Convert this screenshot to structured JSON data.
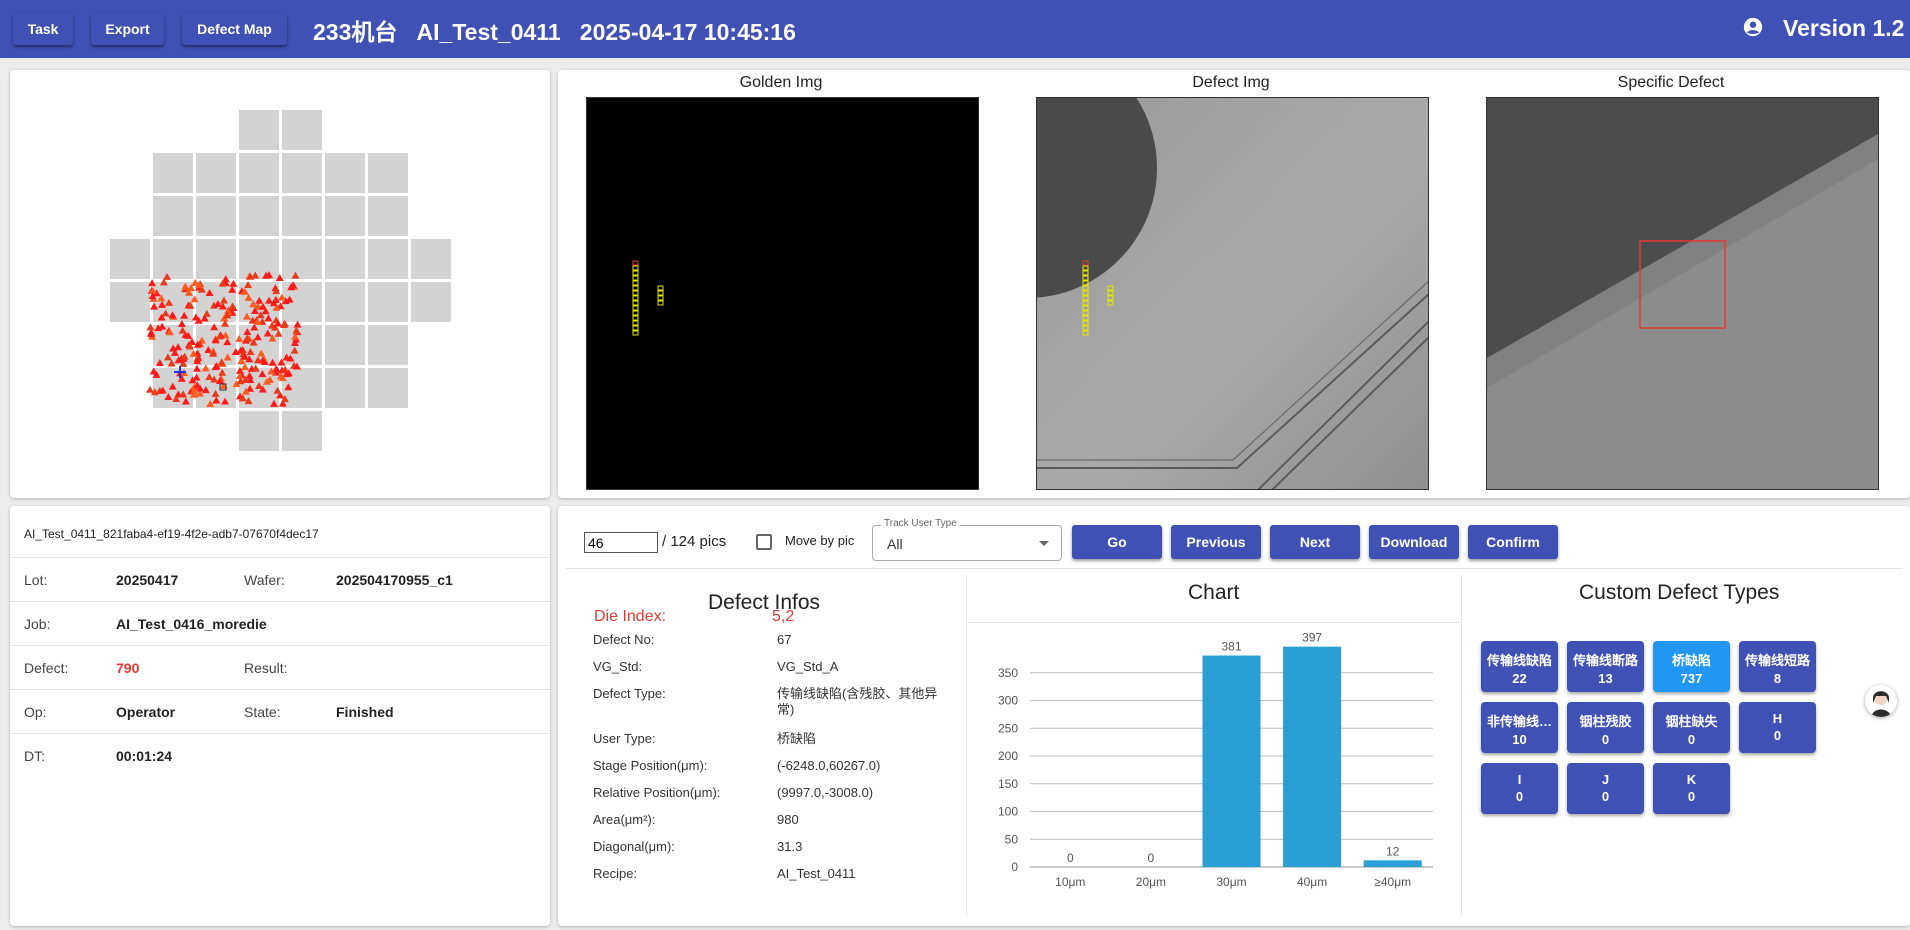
{
  "header": {
    "task_label": "Task",
    "export_label": "Export",
    "defect_map_label": "Defect Map",
    "title": "233机台   AI_Test_0411   2025-04-17 10:45:16",
    "account_icon": "account-circle-icon",
    "version": "Version 1.2"
  },
  "images": {
    "golden_title": "Golden Img",
    "defect_title": "Defect Img",
    "specific_title": "Specific Defect"
  },
  "info": {
    "id": "AI_Test_0411_821faba4-ef19-4f2e-adb7-07670f4dec17",
    "lot_label": "Lot:",
    "lot": "20250417",
    "wafer_label": "Wafer:",
    "wafer": "202504170955_c1",
    "job_label": "Job:",
    "job": "AI_Test_0416_moredie",
    "defect_label": "Defect:",
    "defect": "790",
    "result_label": "Result:",
    "result": "",
    "op_label": "Op:",
    "op": "Operator",
    "state_label": "State:",
    "state": "Finished",
    "dt_label": "DT:",
    "dt": "00:01:24"
  },
  "controls": {
    "page_value": "46",
    "page_total": "/ 124 pics",
    "move_by_pic_label": "Move by pic",
    "track_label": "Track User Type",
    "track_value": "All",
    "go": "Go",
    "previous": "Previous",
    "next": "Next",
    "download": "Download",
    "confirm": "Confirm"
  },
  "defect_infos": {
    "title": "Defect Infos",
    "die_index_label": "Die Index:",
    "die_index": "5,2",
    "rows": [
      {
        "k": "Defect No:",
        "v": "67"
      },
      {
        "k": "VG_Std:",
        "v": "VG_Std_A"
      },
      {
        "k": "Defect Type:",
        "v": "传输线缺陷(含残胶、其他异常)"
      },
      {
        "k": "User Type:",
        "v": "桥缺陷"
      },
      {
        "k": "Stage Position(μm):",
        "v": "(-6248.0,60267.0)"
      },
      {
        "k": "Relative Position(μm):",
        "v": "(9997.0,-3008.0)"
      },
      {
        "k": "Area(μm²):",
        "v": "980"
      },
      {
        "k": "Diagonal(μm):",
        "v": "31.3"
      },
      {
        "k": "Recipe:",
        "v": "AI_Test_0411"
      }
    ]
  },
  "chart_title": "Chart",
  "chart_data": {
    "type": "bar",
    "categories": [
      "10μm",
      "20μm",
      "30μm",
      "40μm",
      "≥40μm"
    ],
    "values": [
      0,
      0,
      381,
      397,
      12
    ],
    "ylim": [
      0,
      400
    ],
    "yticks": [
      0,
      50,
      100,
      150,
      200,
      250,
      300,
      350
    ],
    "grid": true,
    "bar_color": "#2a9fd6"
  },
  "custom_types": {
    "title": "Custom Defect Types",
    "items": [
      {
        "name": "传输线缺陷",
        "count": "22",
        "active": false
      },
      {
        "name": "传输线断路",
        "count": "13",
        "active": false
      },
      {
        "name": "桥缺陷",
        "count": "737",
        "active": true
      },
      {
        "name": "传输线短路",
        "count": "8",
        "active": false
      },
      {
        "name": "非传输线…",
        "count": "10",
        "active": false
      },
      {
        "name": "铟柱残胶",
        "count": "0",
        "active": false
      },
      {
        "name": "铟柱缺失",
        "count": "0",
        "active": false
      },
      {
        "name": "H",
        "count": "0",
        "active": false
      },
      {
        "name": "I",
        "count": "0",
        "active": false
      },
      {
        "name": "J",
        "count": "0",
        "active": false
      },
      {
        "name": "K",
        "count": "0",
        "active": false
      }
    ]
  },
  "colors": {
    "primary": "#3f51b5",
    "active": "#2196f3",
    "alert": "#e53935"
  }
}
